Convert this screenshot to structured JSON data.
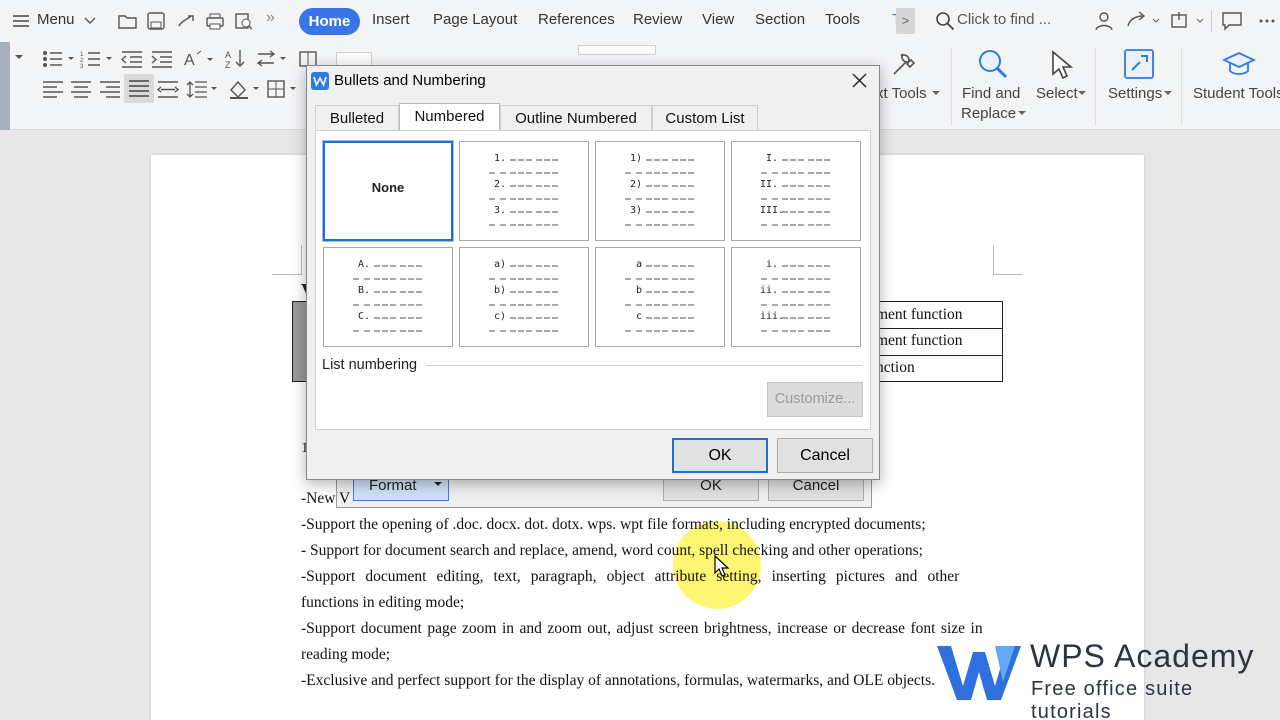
{
  "menubar": {
    "menu_label": "Menu",
    "tabs": [
      "Home",
      "Insert",
      "Page Layout",
      "References",
      "Review",
      "View",
      "Section",
      "Tools"
    ],
    "active_tab": "Home",
    "search_placeholder": "Click to find ..."
  },
  "ribbon": {
    "text_tools": "xt Tools",
    "find_replace_1": "Find and",
    "find_replace_2": "Replace",
    "select": "Select",
    "settings": "Settings",
    "student_tools": "Student Tools"
  },
  "document": {
    "table_cells": [
      "ment function",
      "ment function",
      "nction"
    ],
    "lines": [
      "-Support the opening of .doc. docx. dot. dotx. wps. wpt file formats, including encrypted documents;",
      "- Support for document search and replace, amend, word count, spell checking and other operations;",
      "-Support document editing, text, paragraph, object attribute setting, inserting pictures and other",
      "functions in editing mode;",
      "-Support document page zoom in and zoom out, adjust screen brightness, increase or decrease font size in",
      "reading mode;",
      "-Exclusive and perfect support for the display of annotations, formulas, watermarks, and OLE objects."
    ],
    "partial_new": "-New V",
    "underlying_format": "Format",
    "underlying_ok": "OK",
    "underlying_cancel": "Cancel"
  },
  "dialog": {
    "title": "Bullets and Numbering",
    "tabs": [
      "Bulleted",
      "Numbered",
      "Outline Numbered",
      "Custom List"
    ],
    "active_tab": "Numbered",
    "options": [
      {
        "label": "None",
        "markers": []
      },
      {
        "label": "",
        "markers": [
          "1.",
          "2.",
          "3."
        ]
      },
      {
        "label": "",
        "markers": [
          "1)",
          "2)",
          "3)"
        ]
      },
      {
        "label": "",
        "markers": [
          "I.",
          "II.",
          "III."
        ]
      },
      {
        "label": "",
        "markers": [
          "A.",
          "B.",
          "C."
        ]
      },
      {
        "label": "",
        "markers": [
          "a)",
          "b)",
          "c)"
        ]
      },
      {
        "label": "",
        "markers": [
          "a",
          "b",
          "c"
        ]
      },
      {
        "label": "",
        "markers": [
          "i.",
          "ii.",
          "iii."
        ]
      }
    ],
    "list_numbering_label": "List numbering",
    "customize_label": "Customize...",
    "ok_label": "OK",
    "cancel_label": "Cancel"
  },
  "watermark": {
    "brand": "WPS Academy",
    "tagline": "Free office suite tutorials"
  },
  "colors": {
    "accent": "#3a74e8",
    "selection_border": "#1f6fd0",
    "highlight": "#fff200",
    "wps_blue": "#2f6fe0"
  }
}
